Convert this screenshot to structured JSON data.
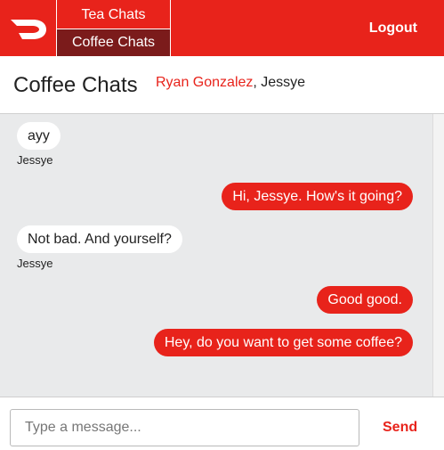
{
  "nav": {
    "logo_icon": "doordash-logo-icon",
    "tabs": [
      {
        "label": "Tea Chats",
        "active": false
      },
      {
        "label": "Coffee Chats",
        "active": true
      }
    ],
    "logout_label": "Logout"
  },
  "header": {
    "title": "Coffee Chats",
    "participants": {
      "active": "Ryan Gonzalez",
      "separator": ", ",
      "other": "Jessye"
    }
  },
  "messages": [
    {
      "direction": "in",
      "text": "ayy",
      "sender": "Jessye"
    },
    {
      "direction": "out",
      "text": "Hi, Jessye. How's it going?"
    },
    {
      "direction": "in",
      "text": "Not bad. And yourself?",
      "sender": "Jessye"
    },
    {
      "direction": "out",
      "text": "Good good."
    },
    {
      "direction": "out",
      "text": "Hey, do you want to get some coffee?"
    }
  ],
  "composer": {
    "placeholder": "Type a message...",
    "send_label": "Send"
  },
  "colors": {
    "brand": "#e8231b",
    "tab_active_bg": "#7b1b1b",
    "chat_bg": "#e9eaeb"
  }
}
